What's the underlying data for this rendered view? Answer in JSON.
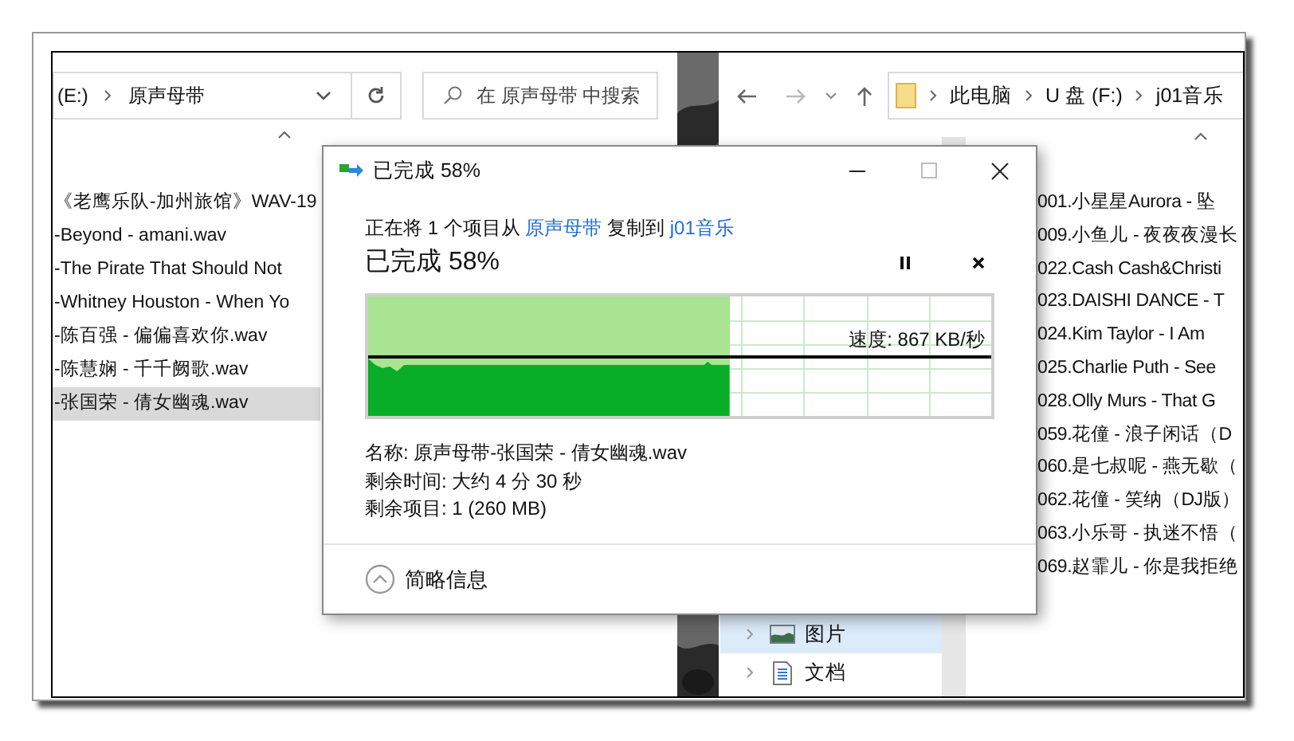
{
  "left_explorer": {
    "address": {
      "drive": "(E:)",
      "folder": "原声母带"
    },
    "search": {
      "placeholder": "在 原声母带 中搜索"
    },
    "files": [
      {
        "name": "《老鹰乐队-加州旅馆》WAV-19",
        "selected": false
      },
      {
        "name": "-Beyond - amani.wav",
        "selected": false
      },
      {
        "name": "-The Pirate That Should Not",
        "selected": false
      },
      {
        "name": "-Whitney Houston - When Yo",
        "selected": false
      },
      {
        "name": "-陈百强 - 偏偏喜欢你.wav",
        "selected": false
      },
      {
        "name": "-陈慧娴 - 千千阙歌.wav",
        "selected": false
      },
      {
        "name": "-张国荣 - 倩女幽魂.wav",
        "selected": true
      }
    ]
  },
  "right_explorer": {
    "address": [
      "此电脑",
      "U 盘 (F:)",
      "j01音乐"
    ],
    "nav_items": [
      {
        "label": "图片",
        "kind": "pictures",
        "selected": true
      },
      {
        "label": "文档",
        "kind": "documents",
        "selected": false
      }
    ],
    "files": [
      {
        "name": "001.小星星Aurora - 坠",
        "selected": false
      },
      {
        "name": "009.小鱼儿 - 夜夜夜漫长",
        "selected": false
      },
      {
        "name": "022.Cash Cash&Christi",
        "selected": false
      },
      {
        "name": "023.DAISHI DANCE - T",
        "selected": false
      },
      {
        "name": "024.Kim Taylor - I Am",
        "selected": false
      },
      {
        "name": "025.Charlie Puth - See",
        "selected": false
      },
      {
        "name": "028.Olly Murs - That G",
        "selected": false
      },
      {
        "name": "059.花僮 - 浪子闲话（D",
        "selected": false
      },
      {
        "name": "060.是七叔呢 - 燕无歇（",
        "selected": false
      },
      {
        "name": "062.花僮 - 笑纳（DJ版）",
        "selected": false
      },
      {
        "name": "063.小乐哥 - 执迷不悟（",
        "selected": false
      },
      {
        "name": "069.赵霏儿 - 你是我拒绝",
        "selected": false
      }
    ]
  },
  "dialog": {
    "title": "已完成 58%",
    "message": {
      "prefix": "正在将 1 个项目从",
      "source": "原声母带",
      "middle": "复制到",
      "destination": "j01音乐"
    },
    "heading": "已完成 58%",
    "progress": {
      "level": 0.58,
      "speed": "速度: 867 KB/秒"
    },
    "details": [
      "名称: 原声母带-张国荣 - 倩女幽魂.wav",
      "剩余时间: 大约 4 分 30 秒",
      "剩余项目: 1 (260 MB)"
    ],
    "toggle": "简略信息"
  }
}
